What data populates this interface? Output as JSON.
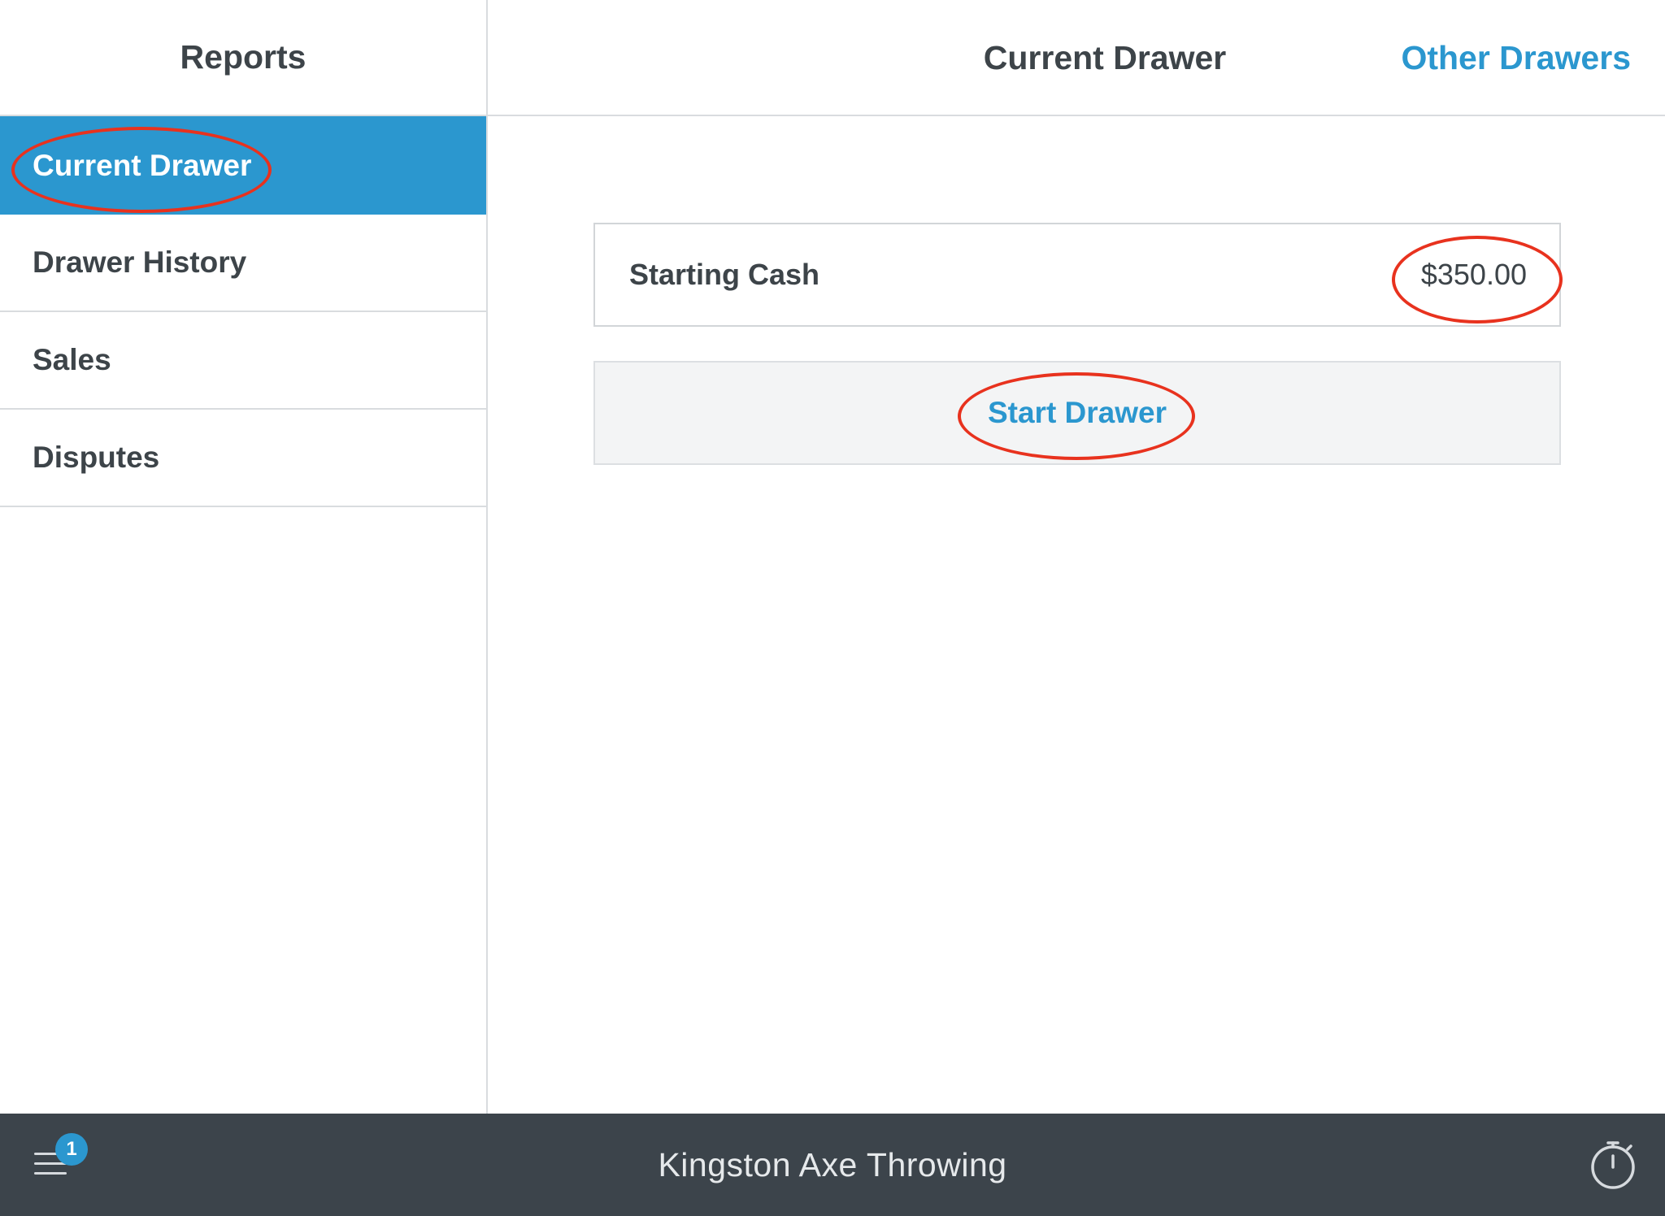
{
  "sidebar": {
    "title": "Reports",
    "items": [
      {
        "label": "Current Drawer",
        "active": true
      },
      {
        "label": "Drawer History",
        "active": false
      },
      {
        "label": "Sales",
        "active": false
      },
      {
        "label": "Disputes",
        "active": false
      }
    ]
  },
  "header": {
    "title": "Current Drawer",
    "other_drawers_label": "Other Drawers"
  },
  "drawer": {
    "starting_cash_label": "Starting Cash",
    "starting_cash_value": "$350.00",
    "start_button_label": "Start Drawer"
  },
  "bottom_bar": {
    "business_name": "Kingston Axe Throwing",
    "notification_count": "1",
    "menu_icon": "hamburger-menu-icon",
    "timer_icon": "stopwatch-icon"
  },
  "colors": {
    "accent": "#2b97cf",
    "bottom_bar": "#3c444b",
    "annotation": "#e8321e",
    "text": "#3d4449"
  }
}
